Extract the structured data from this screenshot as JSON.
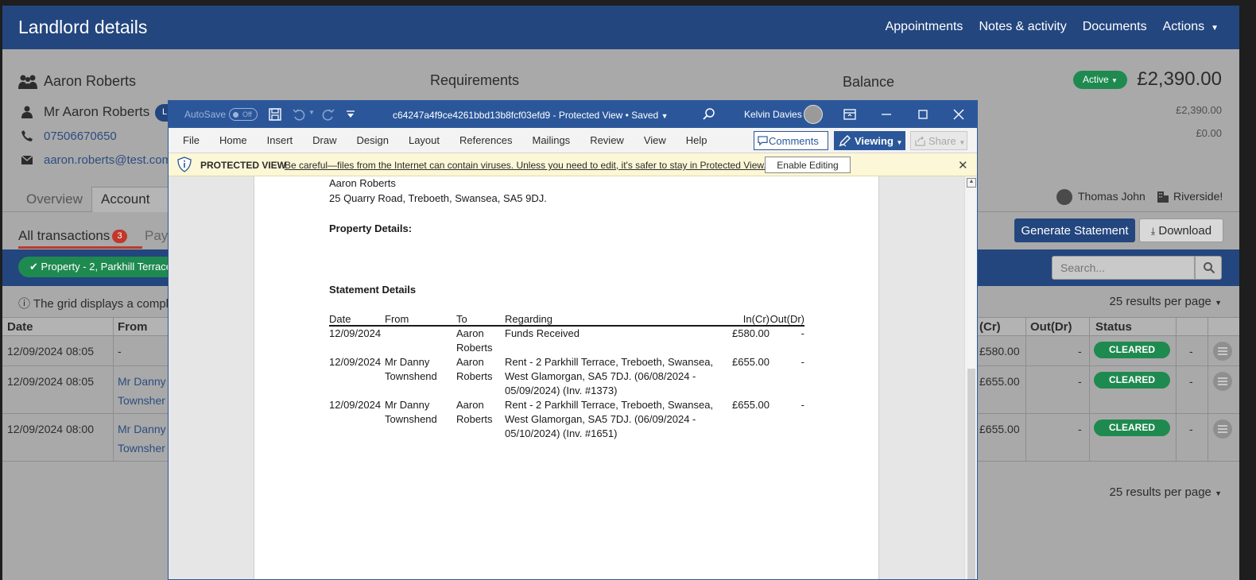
{
  "app": {
    "title": "Landlord details",
    "nav": [
      "Appointments",
      "Notes & activity",
      "Documents",
      "Actions"
    ]
  },
  "contact": {
    "name": "Aaron Roberts",
    "full_title": "Mr Aaron Roberts",
    "phone": "07506670650",
    "email": "aaron.roberts@test.com",
    "pill_text": "L"
  },
  "panels": {
    "requirements_heading": "Requirements",
    "balance_heading": "Balance",
    "status": "Active",
    "balance_total": "£2,390.00",
    "balance_line1": "£2,390.00",
    "balance_line2": "£0.00"
  },
  "tabs": {
    "overview": "Overview",
    "account": "Account"
  },
  "assignment": {
    "agent": "Thomas John",
    "branch": "Riverside!"
  },
  "subtabs": {
    "all": "All transactions",
    "all_count": "3",
    "payments": "Pay"
  },
  "actions": {
    "generate": "Generate Statement",
    "download": "Download"
  },
  "filter": {
    "chip": "Property - 2, Parkhill Terrace",
    "search_placeholder": "Search..."
  },
  "grid": {
    "info": "The grid displays a comple",
    "per_page": "25 results per page",
    "headers": {
      "date": "Date",
      "from": "From",
      "in": "(Cr)",
      "out": "Out(Dr)",
      "status": "Status"
    },
    "rows": [
      {
        "date": "12/09/2024 08:05",
        "from_line1": "-",
        "from_line2": "",
        "in": "£580.00",
        "out": "-",
        "status": "CLEARED",
        "extra": "-"
      },
      {
        "date": "12/09/2024 08:05",
        "from_line1": "Mr Danny",
        "from_line2": "Townsher",
        "in": "£655.00",
        "out": "-",
        "status": "CLEARED",
        "extra": "-"
      },
      {
        "date": "12/09/2024 08:00",
        "from_line1": "Mr Danny",
        "from_line2": "Townsher",
        "in": "£655.00",
        "out": "-",
        "status": "CLEARED",
        "extra": "-"
      }
    ]
  },
  "word": {
    "autosave_label": "AutoSave",
    "autosave_state": "Off",
    "doc_title": "c64247a4f9ce4261bbd13b8fcf03efd9  -  Protected View • Saved",
    "user": "Kelvin Davies",
    "ribbon_tabs": [
      "File",
      "Home",
      "Insert",
      "Draw",
      "Design",
      "Layout",
      "References",
      "Mailings",
      "Review",
      "View",
      "Help"
    ],
    "comments": "Comments",
    "viewing": "Viewing",
    "share": "Share",
    "protected_label": "PROTECTED VIEW",
    "protected_message": "Be careful—files from the Internet can contain viruses. Unless you need to edit, it's safer to stay in Protected View.",
    "enable_editing": "Enable Editing"
  },
  "document": {
    "recipient": "Aaron Roberts",
    "address": "25 Quarry Road, Treboeth, Swansea, SA5 9DJ.",
    "property_heading": "Property Details:",
    "statement_heading": "Statement Details",
    "columns": {
      "date": "Date",
      "from": "From",
      "to": "To",
      "regarding": "Regarding",
      "in": "In(Cr)",
      "out": "Out(Dr)"
    },
    "rows": [
      {
        "date": "12/09/2024",
        "from": "",
        "to": "Aaron Roberts",
        "regarding": "Funds Received",
        "in": "£580.00",
        "out": "-"
      },
      {
        "date": "12/09/2024",
        "from": "Mr Danny Townshend",
        "to": "Aaron Roberts",
        "regarding": "Rent - 2 Parkhill Terrace, Treboeth, Swansea, West Glamorgan, SA5 7DJ. (06/08/2024 - 05/09/2024) (Inv. #1373)",
        "in": "£655.00",
        "out": "-"
      },
      {
        "date": "12/09/2024",
        "from": "Mr Danny Townshend",
        "to": "Aaron Roberts",
        "regarding": "Rent - 2 Parkhill Terrace, Treboeth, Swansea, West Glamorgan, SA5 7DJ. (06/09/2024 - 05/10/2024) (Inv. #1651)",
        "in": "£655.00",
        "out": "-"
      }
    ]
  },
  "colors": {
    "header": "#23467e",
    "word_blue": "#2b579a",
    "success": "#1f8a50",
    "badge_red": "#c0392b"
  }
}
